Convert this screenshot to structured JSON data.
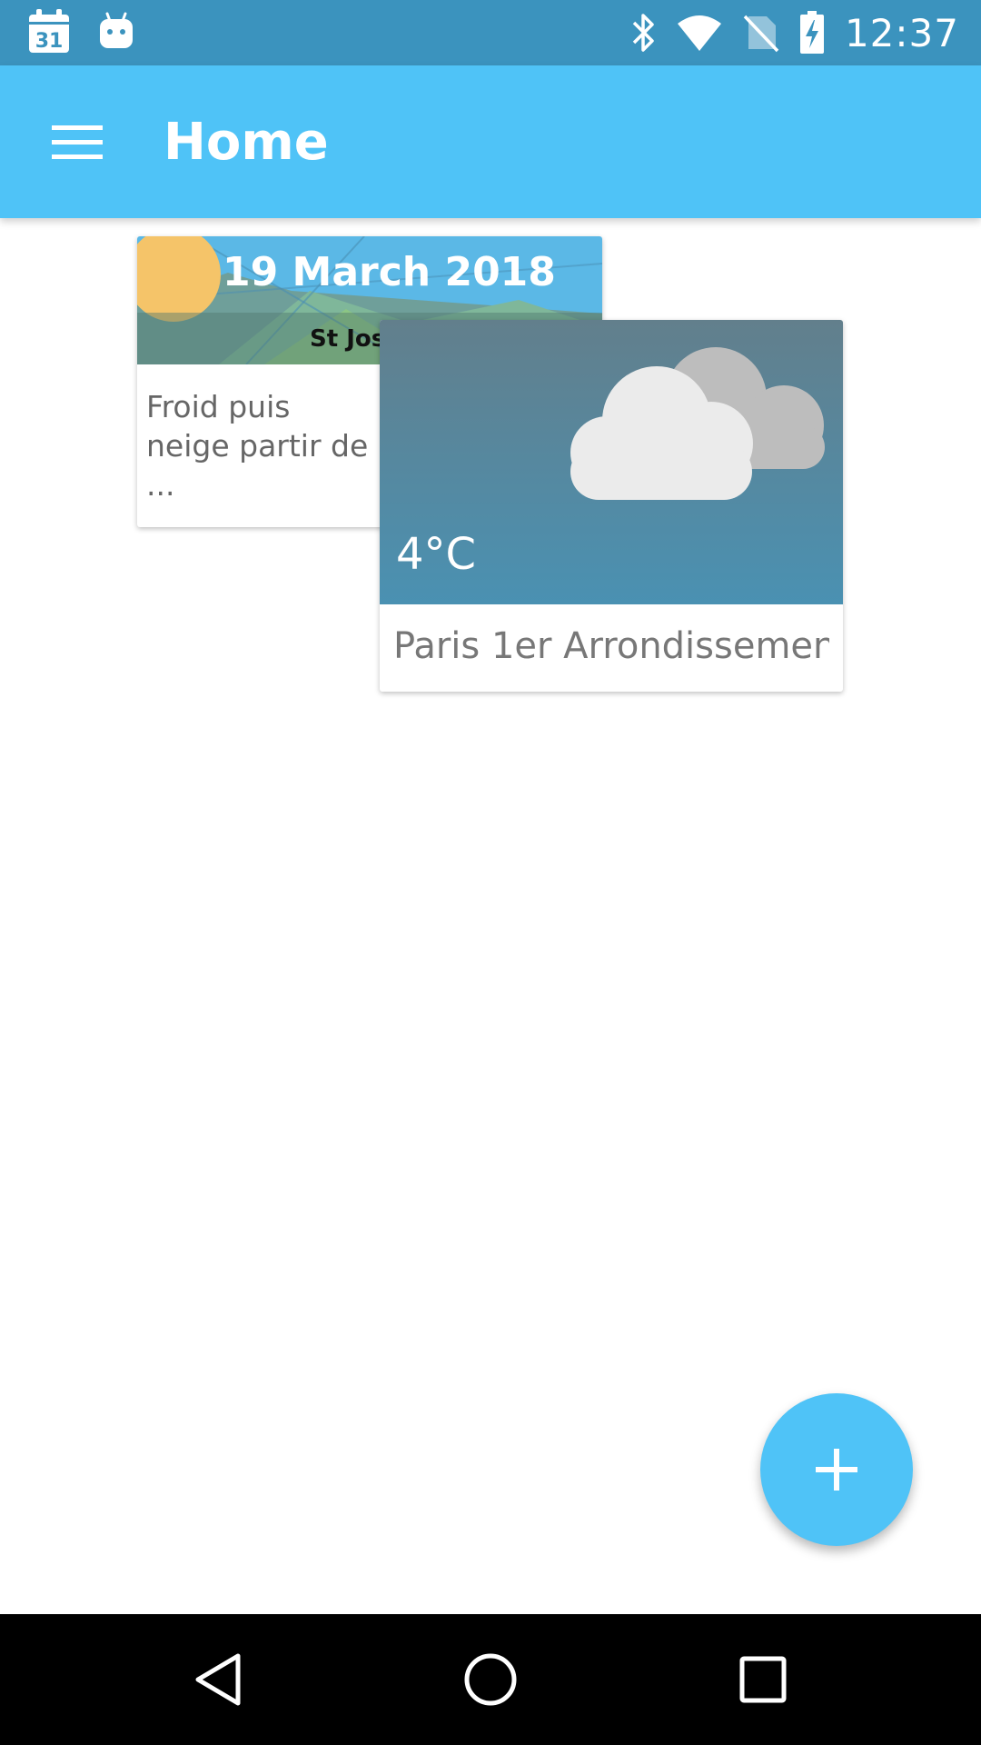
{
  "status_bar": {
    "time": "12:37",
    "calendar_day": "31",
    "icons": [
      "calendar-icon",
      "android-icon",
      "bluetooth-icon",
      "wifi-icon",
      "no-sim-icon",
      "battery-charging-icon"
    ]
  },
  "app_bar": {
    "title": "Home",
    "menu_icon": "menu-icon"
  },
  "cards": {
    "daily": {
      "date": "19 March 2018",
      "saint": "St Jos",
      "text": "Froid puis neige partir de ..."
    },
    "weather": {
      "temperature": "4°C",
      "location": "Paris 1er Arrondissemen..",
      "icon": "cloud-icon"
    }
  },
  "fab": {
    "icon": "plus-icon"
  },
  "nav_bar": {
    "icons": [
      "back-icon",
      "home-icon",
      "recents-icon"
    ]
  },
  "colors": {
    "status_bar": "#3b93be",
    "app_bar": "#4fc3f7",
    "fab": "#4fc3f7",
    "weather_panel_top": "#627f8c",
    "weather_panel_bottom": "#4a91b2"
  }
}
